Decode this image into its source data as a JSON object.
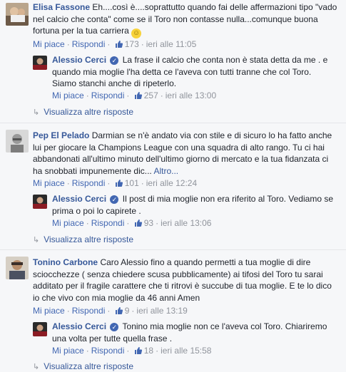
{
  "colors": {
    "link": "#365899",
    "action": "#4267b2",
    "meta": "#90949c",
    "like": "#4267b2"
  },
  "common": {
    "like_label": "Mi piace",
    "reply_label": "Rispondi",
    "show_more_replies": "Visualizza altre risposte",
    "more_label": "Altro...",
    "sep": "·"
  },
  "comments": [
    {
      "author": "Elisa Fassone",
      "text": "Eh....così è....soprattutto quando fai delle affermazioni tipo \"vado nel calcio che conta\" come se il Toro non contasse nulla...comunque buona fortuna per la tua carriera",
      "likes": "173",
      "time": "ieri alle 11:05",
      "reply": {
        "author": "Alessio Cerci",
        "text": "La frase il calcio che conta non è stata detta da me . e quando mia moglie l'ha detta ce l'aveva con tutti tranne che col Toro. Siamo stanchi anche di ripeterlo.",
        "likes": "257",
        "time": "ieri alle 13:00"
      }
    },
    {
      "author": "Pep El Pelado",
      "text": "Darmian se n'è andato via con stile e di sicuro lo ha fatto anche lui per giocare la Champions League con una squadra di alto rango. Tu ci hai abbandonati all'ultimo minuto dell'ultimo giorno di mercato e la tua fidanzata ci ha snobbati impunemente dic...",
      "likes": "101",
      "time": "ieri alle 12:24",
      "reply": {
        "author": "Alessio Cerci",
        "text": "Il post di mia moglie non era riferito al Toro. Vediamo se prima o poi lo capirete .",
        "likes": "93",
        "time": "ieri alle 13:06"
      }
    },
    {
      "author": "Tonino Carbone",
      "text": "Caro Alessio fino a quando permetti a tua moglie di dire sciocchezze ( senza chiedere scusa pubblicamente) ai tifosi del Toro tu sarai additato per il fragile carattere che ti ritrovi è succube di tua moglie. E te lo dico io che vivo con mia moglie da 46 anni Amen",
      "likes": "9",
      "time": "ieri alle 13:19",
      "reply": {
        "author": "Alessio Cerci",
        "text": "Tonino mia moglie non ce l'aveva col Toro. Chiariremo una volta per tutte quella frase .",
        "likes": "18",
        "time": "ieri alle 15:58"
      }
    }
  ]
}
